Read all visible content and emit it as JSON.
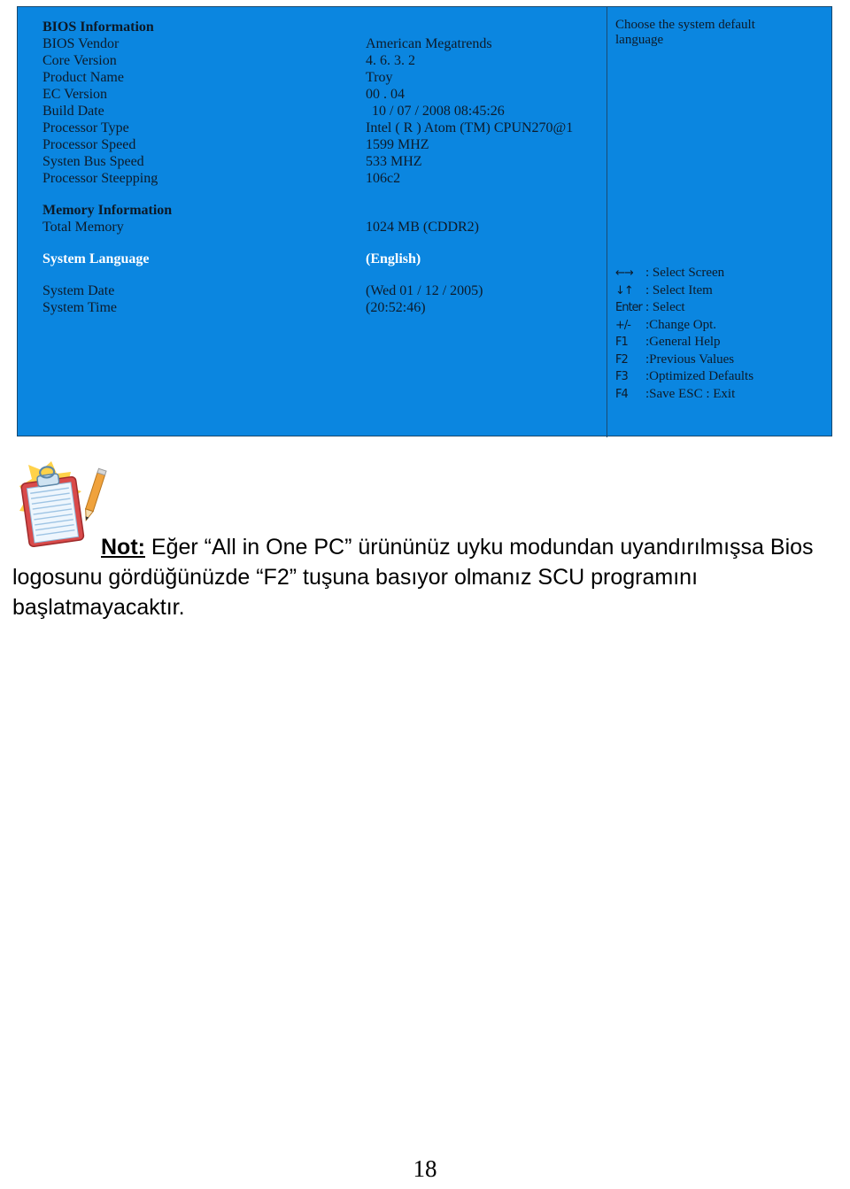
{
  "bios": {
    "panel_color": "#0b86e0",
    "text_color": "#0d1b2a",
    "selected_color": "#ffffff",
    "sections": [
      {
        "heading": "BIOS Information",
        "rows": [
          {
            "label": "BIOS Vendor",
            "value": "American Megatrends"
          },
          {
            "label": "Core Version",
            "value": "4. 6. 3. 2"
          },
          {
            "label": "Product Name",
            "value": "Troy"
          },
          {
            "label": "EC Version",
            "value": "00 . 04"
          },
          {
            "label": "Build Date",
            "value": "10 / 07 / 2008    08:45:26"
          },
          {
            "label": "Processor Type",
            "value": "Intel ( R ) Atom (TM) CPUN270@1"
          },
          {
            "label": "Processor Speed",
            "value": "1599 MHZ"
          },
          {
            "label": "Systen Bus Speed",
            "value": "533 MHZ"
          },
          {
            "label": "Processor Steepping",
            "value": "106c2"
          }
        ]
      },
      {
        "heading": "Memory Information",
        "rows": [
          {
            "label": "Total Memory",
            "value": "1024 MB (CDDR2)"
          }
        ]
      }
    ],
    "language_row": {
      "label": "System Language",
      "value": "(English)"
    },
    "datetime_rows": [
      {
        "label": "System Date",
        "value": "(Wed 01 / 12 / 2005)"
      },
      {
        "label": "System Time",
        "value": "(20:52:46)"
      }
    ],
    "help": {
      "description": "Choose the system default language",
      "keys": [
        {
          "glyph": "←→",
          "label": ": Select Screen"
        },
        {
          "glyph": "↓↑",
          "label": ": Select  Item"
        },
        {
          "glyph": "Enter",
          "label": ": Select"
        },
        {
          "glyph": "+/-",
          "label": ":Change Opt."
        },
        {
          "glyph": "F1",
          "label": ":General  Help"
        },
        {
          "glyph": "F2",
          "label": ":Previous Values"
        },
        {
          "glyph": "F3",
          "label": ":Optimized Defaults"
        },
        {
          "glyph": "F4",
          "label": ":Save ESC :  Exit"
        }
      ]
    }
  },
  "note": {
    "label": "Not:",
    "body": " Eğer “All in One PC” ürününüz uyku modundan uyandırılmışsa Bios logosunu gördüğünüzde “F2” tuşuna basıyor olmanız SCU programını başlatmayacaktır."
  },
  "page": {
    "number": "18"
  }
}
